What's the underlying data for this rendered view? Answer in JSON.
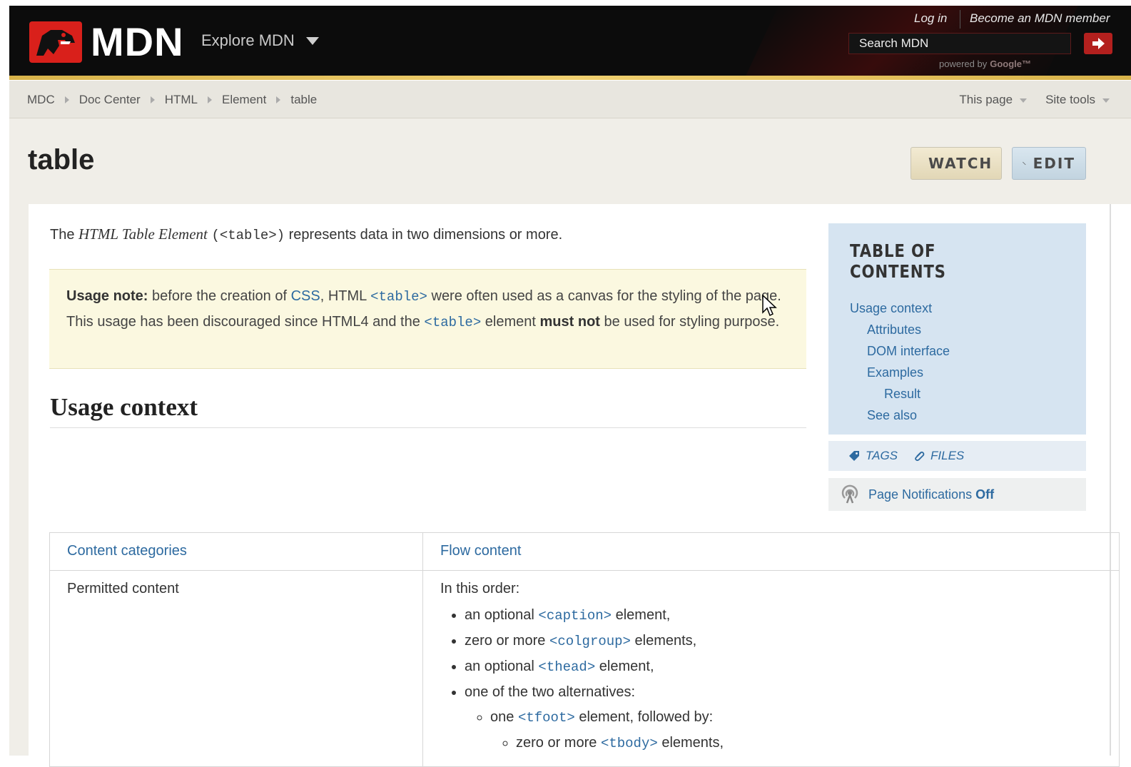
{
  "header": {
    "logo_text": "MDN",
    "explore_label": "Explore MDN",
    "login_label": "Log in",
    "become_member_label": "Become an MDN member",
    "search": {
      "placeholder": "Search MDN"
    },
    "powered_by": "powered by",
    "powered_brand": "Google™"
  },
  "breadcrumb": {
    "items": [
      "MDC",
      "Doc Center",
      "HTML",
      "Element",
      "table"
    ]
  },
  "page_tools": {
    "this_page": "This page",
    "site_tools": "Site tools"
  },
  "title": "table",
  "buttons": {
    "watch": "WATCH",
    "edit": "EDIT"
  },
  "intro": {
    "prefix": "The ",
    "em": "HTML Table Element",
    "code": "(<table>)",
    "suffix": " represents data in two dimensions or more."
  },
  "note": {
    "bold_lead": "Usage note:",
    "t1": " before the creation of ",
    "css_link": "CSS",
    "t2": ", HTML ",
    "code1": "<table>",
    "t3": " were often used as a canvas for the styling of the page. This usage has been discouraged since HTML4 and the ",
    "code2": "<table>",
    "t4": " element ",
    "bold_must": "must not",
    "t5": " be used for styling purpose."
  },
  "usage_heading": "Usage context",
  "toc": {
    "title": "TABLE OF CONTENTS",
    "items": [
      "Usage context",
      "Attributes",
      "DOM interface",
      "Examples",
      "Result",
      "See also"
    ]
  },
  "tags_label": "TAGS",
  "files_label": "FILES",
  "notifications": {
    "label": "Page Notifications",
    "state": "Off"
  },
  "table": {
    "row1": {
      "key": "Content categories",
      "value": "Flow content"
    },
    "row2": {
      "key": "Permitted content",
      "lead": "In this order:",
      "b1_pre": "an optional ",
      "b1_code": "<caption>",
      "b1_post": " element,",
      "b2_pre": "zero or more ",
      "b2_code": "<colgroup>",
      "b2_post": " elements,",
      "b3_pre": "an optional ",
      "b3_code": "<thead>",
      "b3_post": " element,",
      "b4": "one of the two alternatives:",
      "s1_pre": "one ",
      "s1_code": "<tfoot>",
      "s1_post": " element, followed by:",
      "ss1_pre": "zero or more ",
      "ss1_code": "<tbody>",
      "ss1_post": " elements,"
    }
  },
  "colors": {
    "header_bg": "#0c0c0c",
    "brand_red": "#d9201b",
    "link": "#2d6aa0",
    "note_bg": "#fbf8e0",
    "toc_bg": "#d6e4f1"
  }
}
